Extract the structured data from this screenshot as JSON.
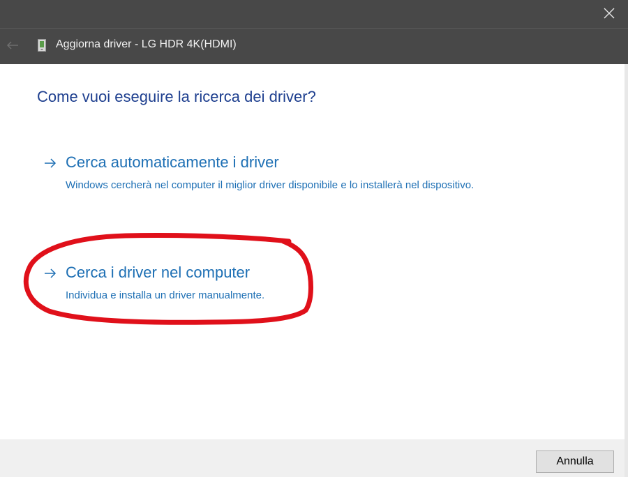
{
  "window": {
    "title": "Aggiorna driver - LG HDR 4K(HDMI)",
    "close_icon": "close-icon",
    "back_icon": "back-arrow-icon",
    "device_icon": "monitor-device-icon"
  },
  "main": {
    "heading": "Come vuoi eseguire la ricerca dei driver?",
    "options": [
      {
        "title": "Cerca automaticamente i driver",
        "description": "Windows cercherà nel computer il miglior driver disponibile e lo installerà nel dispositivo.",
        "icon": "arrow-right-icon"
      },
      {
        "title": "Cerca i driver nel computer",
        "description": "Individua e installa un driver manualmente.",
        "icon": "arrow-right-icon"
      }
    ]
  },
  "footer": {
    "cancel_label": "Annulla"
  },
  "colors": {
    "titlebar": "#484848",
    "heading": "#1e3f8f",
    "link": "#1d6fb4",
    "annotation": "#e0101a"
  }
}
